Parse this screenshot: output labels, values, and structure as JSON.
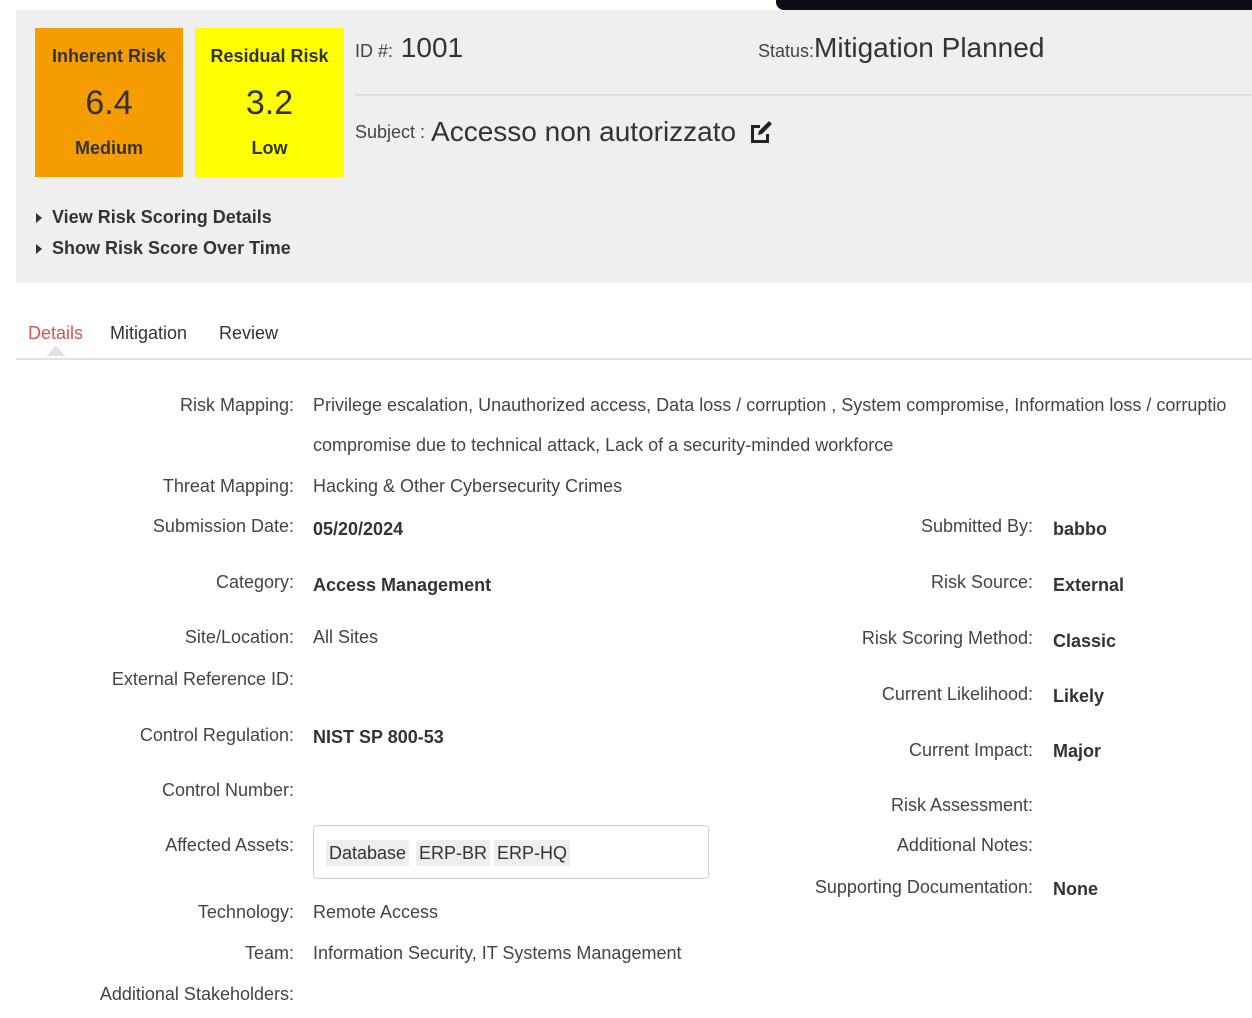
{
  "header": {
    "inherent": {
      "label": "Inherent Risk",
      "score": "6.4",
      "level": "Medium",
      "color": "#f59c00"
    },
    "residual": {
      "label": "Residual Risk",
      "score": "3.2",
      "level": "Low",
      "color": "#ffff00"
    },
    "id_label": "ID #:",
    "id_value": "1001",
    "status_label": "Status:",
    "status_value": "Mitigation Planned",
    "subject_label": "Subject :",
    "subject_value": "Accesso non autorizzato",
    "edit_icon": "edit-icon",
    "expanders": [
      "View Risk Scoring Details",
      "Show Risk Score Over Time"
    ]
  },
  "tabs": [
    {
      "label": "Details",
      "active": true
    },
    {
      "label": "Mitigation",
      "active": false
    },
    {
      "label": "Review",
      "active": false
    }
  ],
  "accent_color": "#d9534f",
  "details": {
    "risk_mapping": {
      "label": "Risk Mapping:",
      "line1": "Privilege escalation, Unauthorized access, Data loss / corruption , System compromise, Information loss / corruptio",
      "line2": "compromise due to technical attack, Lack of a security-minded workforce"
    },
    "threat_mapping": {
      "label": "Threat Mapping:",
      "value": "Hacking & Other Cybersecurity Crimes"
    },
    "submission_date": {
      "label": "Submission Date:",
      "value": "05/20/2024"
    },
    "category": {
      "label": "Category:",
      "value": "Access Management"
    },
    "site_location": {
      "label": "Site/Location:",
      "value": "All Sites"
    },
    "external_ref": {
      "label": "External Reference ID:",
      "value": ""
    },
    "control_regulation": {
      "label": "Control Regulation:",
      "value": "NIST SP 800-53"
    },
    "control_number": {
      "label": "Control Number:",
      "value": ""
    },
    "affected_assets": {
      "label": "Affected Assets:",
      "values": [
        "Database",
        "ERP-BR",
        "ERP-HQ"
      ]
    },
    "technology": {
      "label": "Technology:",
      "value": "Remote Access"
    },
    "team": {
      "label": "Team:",
      "value": "Information Security, IT Systems Management"
    },
    "additional_stakeholders": {
      "label": "Additional Stakeholders:",
      "value": ""
    },
    "submitted_by": {
      "label": "Submitted By:",
      "value": "babbo"
    },
    "risk_source": {
      "label": "Risk Source:",
      "value": "External"
    },
    "risk_scoring_method": {
      "label": "Risk Scoring Method:",
      "value": "Classic"
    },
    "current_likelihood": {
      "label": "Current Likelihood:",
      "value": "Likely"
    },
    "current_impact": {
      "label": "Current Impact:",
      "value": "Major"
    },
    "risk_assessment": {
      "label": "Risk Assessment:",
      "value": ""
    },
    "additional_notes": {
      "label": "Additional Notes:",
      "value": ""
    },
    "supporting_documentation": {
      "label": "Supporting Documentation:",
      "value": "None"
    }
  }
}
